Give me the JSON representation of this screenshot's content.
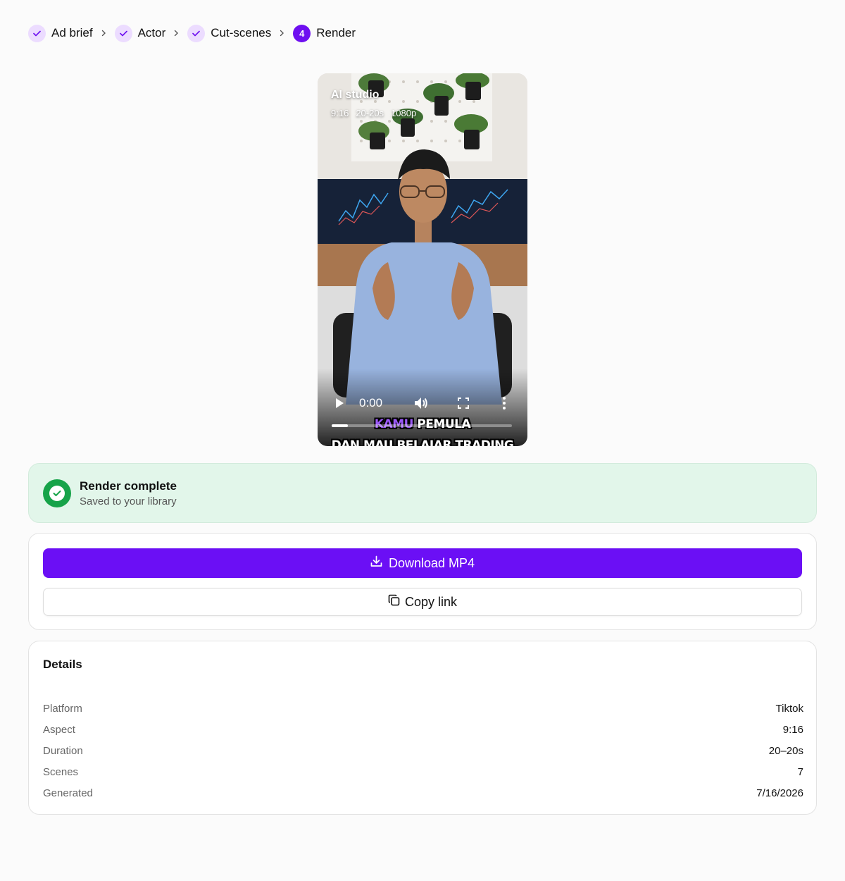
{
  "stepper": {
    "steps": [
      {
        "label": "Ad brief",
        "state": "done"
      },
      {
        "label": "Actor",
        "state": "done"
      },
      {
        "label": "Cut-scenes",
        "state": "done"
      },
      {
        "label": "Render",
        "state": "active",
        "number": "4"
      }
    ]
  },
  "video": {
    "title": "AI studio",
    "meta": [
      "9:16",
      "20-20s",
      "1080p"
    ],
    "caption_line1_highlight": "KAMU",
    "caption_line1_rest": "PEMULA",
    "caption_line2": "DAN MAU BELAJAR TRADING",
    "time": "0:00",
    "progress_fraction": 0.09
  },
  "banner": {
    "title": "Render complete",
    "subtitle": "Saved to your library"
  },
  "actions": {
    "download_label": "Download MP4",
    "copy_label": "Copy link"
  },
  "details": {
    "title": "Details",
    "rows": [
      {
        "label": "Platform",
        "value": "Tiktok"
      },
      {
        "label": "Aspect",
        "value": "9:16"
      },
      {
        "label": "Duration",
        "value": "20–20s"
      },
      {
        "label": "Scenes",
        "value": "7"
      },
      {
        "label": "Generated",
        "value": "7/16/2026"
      }
    ]
  },
  "colors": {
    "accent": "#6b0ff5",
    "step_done_bg": "#ecdcff",
    "success": "#16a349",
    "success_bg": "#e2f6ea"
  }
}
